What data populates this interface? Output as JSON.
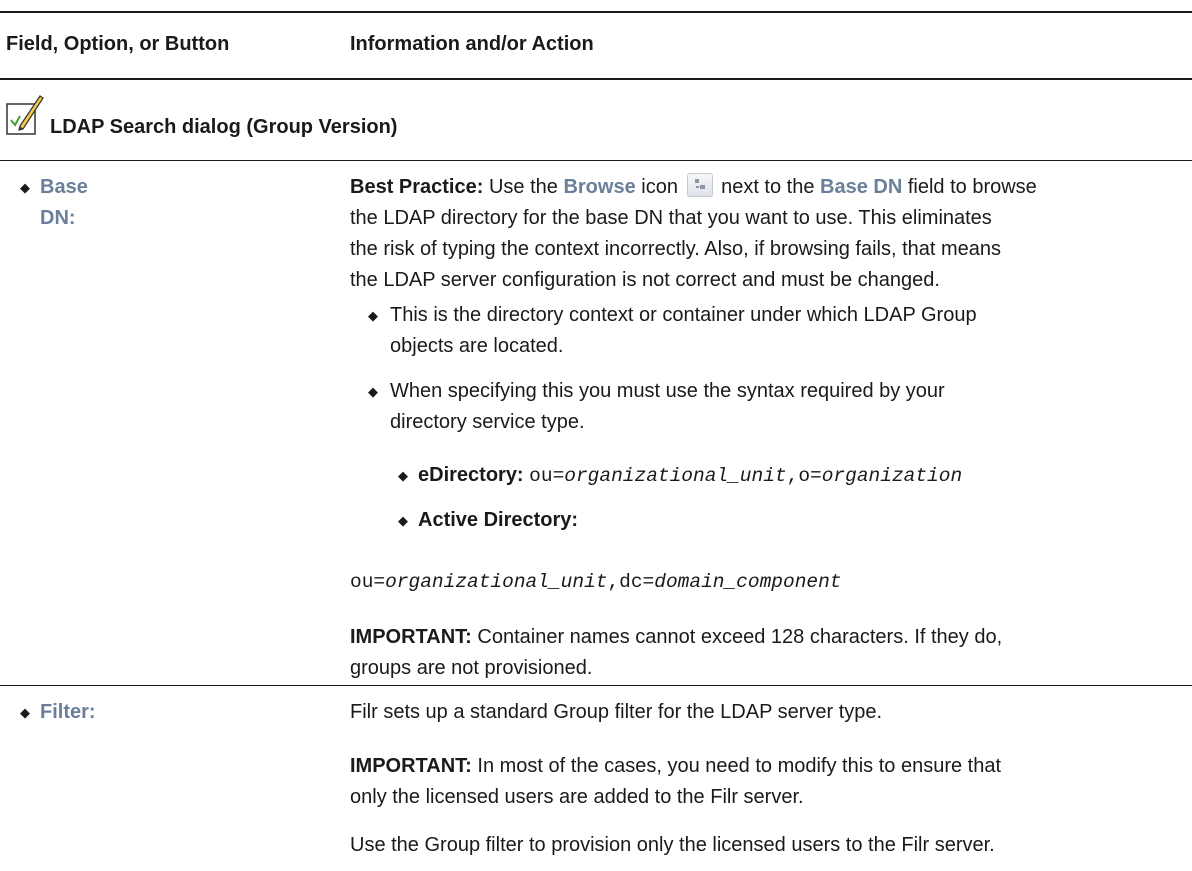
{
  "header": {
    "col1": "Field, Option, or Button",
    "col2": "Information and/or Action"
  },
  "section": {
    "title": "LDAP Search dialog (Group Version)",
    "icon": "checklist-pencil-icon"
  },
  "rows": {
    "base_dn": {
      "label": "Base DN:",
      "bp_prefix": "Best Practice:",
      "bp_text1": " Use the ",
      "bp_browse": "Browse",
      "bp_text2": " icon ",
      "bp_text3": " next to the ",
      "bp_basedn": "Base DN",
      "bp_text4": " field to browse",
      "bp_line2": "the LDAP directory for the base DN that you want to use. This eliminates",
      "bp_line3": "the risk of typing the context incorrectly. Also, if browsing fails, that means",
      "bp_line4": "the LDAP server configuration is not correct and must be changed.",
      "item1_line1": "This is the directory context or container under which LDAP Group",
      "item1_line2": "objects are located.",
      "item2_line1": "When specifying this you must use the syntax required by your",
      "item2_line2": "directory service type.",
      "edir_label": "eDirectory:",
      "edir_ou": "ou=",
      "edir_ou_val": "organizational_unit",
      "edir_o": ",o=",
      "edir_o_val": "organization",
      "ad_label": "Active Directory:",
      "ad_ou": "ou=",
      "ad_ou_val": "organizational_unit",
      "ad_dc": ",dc=",
      "ad_dc_val": "domain_component",
      "imp_prefix": "IMPORTANT:",
      "imp_line1": " Container names cannot exceed 128 characters. If they do,",
      "imp_line2": "groups are not provisioned."
    },
    "filter": {
      "label": "Filter:",
      "line1": "Filr sets up a standard Group filter for the LDAP server type.",
      "imp_prefix": "IMPORTANT:",
      "imp_line1": " In most of the cases, you need to modify this to ensure that",
      "imp_line2": "only the licensed users are added to the Filr server.",
      "line3": "Use the Group filter to provision only the licensed users to the Filr server."
    }
  }
}
